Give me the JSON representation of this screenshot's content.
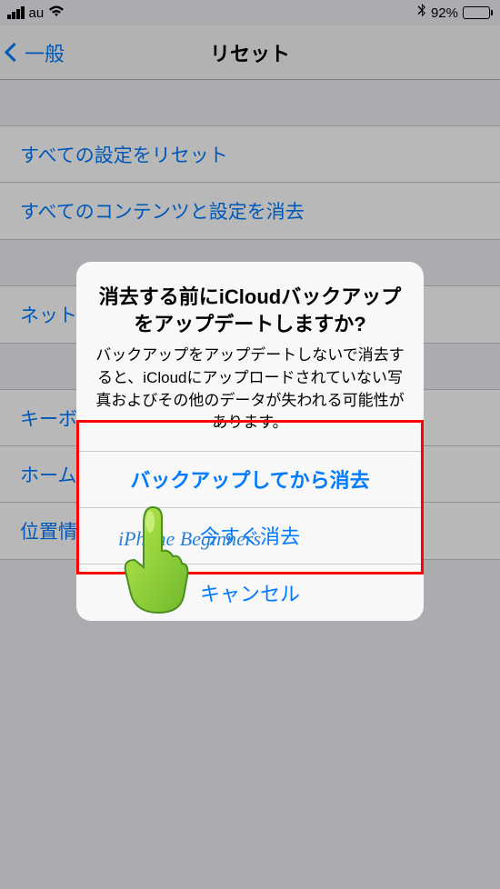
{
  "status": {
    "carrier": "au",
    "bluetooth": "✻",
    "battery_pct": "92%"
  },
  "nav": {
    "back_label": "一般",
    "title": "リセット"
  },
  "groups": [
    {
      "items": [
        {
          "label": "すべての設定をリセット"
        },
        {
          "label": "すべてのコンテンツと設定を消去"
        }
      ]
    },
    {
      "items": [
        {
          "label": "ネットワーク設定をリセット"
        }
      ]
    },
    {
      "items": [
        {
          "label": "キーボードの変換学習をリセット"
        },
        {
          "label": "ホーム画面のレイアウトをリセット"
        },
        {
          "label": "位置情報とプライバシーをリセット"
        }
      ]
    }
  ],
  "alert": {
    "title": "消去する前にiCloudバックアップをアップデートしますか?",
    "message": "バックアップをアップデートしないで消去すると、iCloudにアップロードされていない写真およびその他のデータが失われる可能性があります。",
    "btn_backup": "バックアップしてから消去",
    "btn_erase": "今すぐ消去",
    "btn_cancel": "キャンセル"
  },
  "watermark": "iPhone Beginners"
}
